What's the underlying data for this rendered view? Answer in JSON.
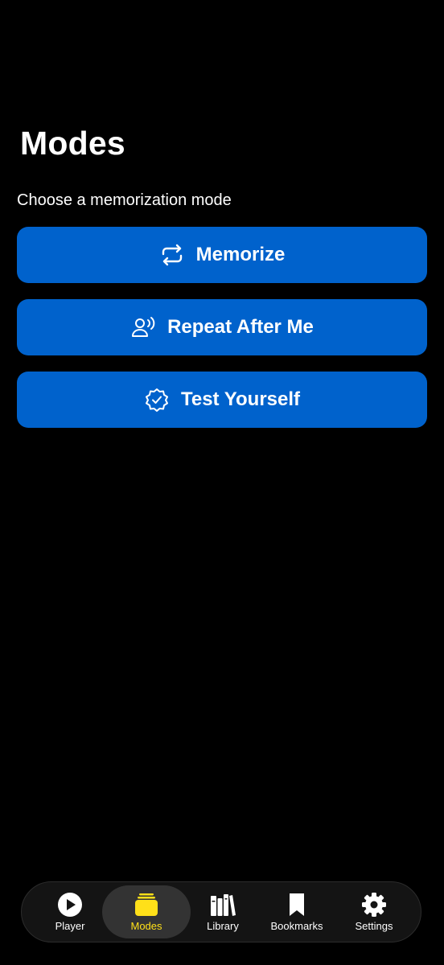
{
  "page": {
    "title": "Modes",
    "subtitle": "Choose a memorization mode"
  },
  "modes": [
    {
      "label": "Memorize",
      "icon": "repeat-arrows-icon"
    },
    {
      "label": "Repeat After Me",
      "icon": "person-speaking-icon"
    },
    {
      "label": "Test Yourself",
      "icon": "checkmark-seal-icon"
    }
  ],
  "tab_bar": {
    "items": [
      {
        "label": "Player",
        "icon": "play-circle-icon",
        "active": false
      },
      {
        "label": "Modes",
        "icon": "stack-icon",
        "active": true
      },
      {
        "label": "Library",
        "icon": "books-icon",
        "active": false
      },
      {
        "label": "Bookmarks",
        "icon": "bookmark-icon",
        "active": false
      },
      {
        "label": "Settings",
        "icon": "gear-icon",
        "active": false
      }
    ]
  },
  "colors": {
    "background": "#000000",
    "button_blue": "#0062CC",
    "active_tab_accent": "#FFE019",
    "text": "#FFFFFF"
  }
}
